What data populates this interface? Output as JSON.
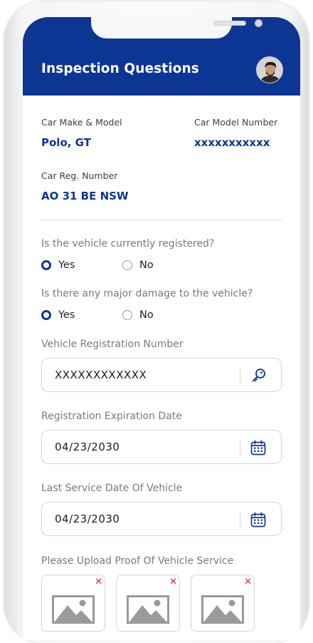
{
  "header": {
    "title": "Inspection Questions",
    "avatar_icon": "user-avatar"
  },
  "car": {
    "make_model_label": "Car Make & Model",
    "make_model_value": "Polo, GT",
    "model_number_label": "Car Model Number",
    "model_number_value": "xxxxxxxxxxx",
    "reg_label": "Car Reg. Number",
    "reg_value": "AO 31 BE NSW"
  },
  "questions": [
    {
      "text": "Is the vehicle currently registered?",
      "options": [
        "Yes",
        "No"
      ],
      "selected": "Yes"
    },
    {
      "text": "Is there any major damage to the vehicle?",
      "options": [
        "Yes",
        "No"
      ],
      "selected": "Yes"
    }
  ],
  "fields": {
    "registration_number": {
      "label": "Vehicle Registration Number",
      "value": "XXXXXXXXXXXX",
      "icon": "key-icon"
    },
    "expiration_date": {
      "label": "Registration Expiration Date",
      "value": "04/23/2030",
      "icon": "calendar-icon"
    },
    "last_service_date": {
      "label": "Last Service Date Of Vehicle",
      "value": "04/23/2030",
      "icon": "calendar-icon"
    }
  },
  "upload": {
    "label": "Please Upload Proof Of Vehicle Service",
    "remove_glyph": "✕",
    "items": [
      "image-placeholder",
      "image-placeholder",
      "image-placeholder"
    ]
  },
  "colors": {
    "primary": "#0d3594",
    "remove": "#e0242d",
    "text_muted": "#7a7a7a"
  }
}
